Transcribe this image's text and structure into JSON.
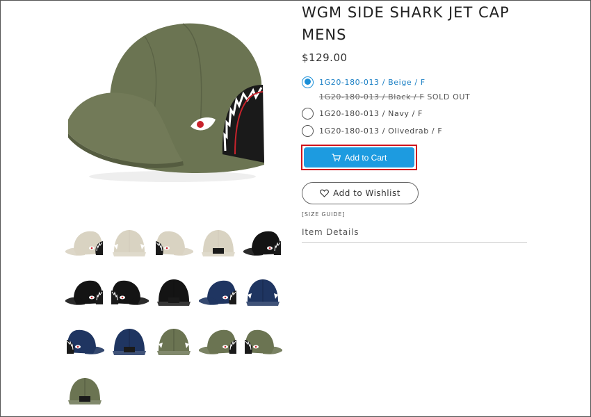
{
  "product": {
    "title": "WGM SIDE SHARK JET CAP MENS",
    "price": "$129.00"
  },
  "options": [
    {
      "label": "1G20-180-013 / Beige / F",
      "selected": true,
      "sold_out": false
    },
    {
      "label": "1G20-180-013 / Black / F",
      "selected": false,
      "sold_out": true,
      "sold_out_text": "SOLD OUT"
    },
    {
      "label": "1G20-180-013 / Navy / F",
      "selected": false,
      "sold_out": false
    },
    {
      "label": "1G20-180-013 / Olivedrab / F",
      "selected": false,
      "sold_out": false
    }
  ],
  "actions": {
    "add_to_cart": "Add to Cart",
    "add_to_wishlist": "Add to Wishlist",
    "size_guide": "[SIZE GUIDE]",
    "item_details": "Item Details"
  },
  "colors": {
    "accent": "#1d9be0",
    "highlight_outline": "#d0131b",
    "olive": "#6b7452",
    "beige": "#d9d3c2",
    "black": "#141414",
    "navy": "#1f3561"
  },
  "thumbnails": [
    {
      "color": "beige",
      "view": "side-left"
    },
    {
      "color": "beige",
      "view": "front"
    },
    {
      "color": "beige",
      "view": "side-right"
    },
    {
      "color": "beige",
      "view": "back"
    },
    {
      "color": "black",
      "view": "side-left"
    },
    {
      "color": "black",
      "view": "side-left"
    },
    {
      "color": "black",
      "view": "side-right"
    },
    {
      "color": "black",
      "view": "back"
    },
    {
      "color": "navy",
      "view": "side-left"
    },
    {
      "color": "navy",
      "view": "front"
    },
    {
      "color": "navy",
      "view": "side-right"
    },
    {
      "color": "navy",
      "view": "back"
    },
    {
      "color": "olive",
      "view": "front"
    },
    {
      "color": "olive",
      "view": "side-left"
    },
    {
      "color": "olive",
      "view": "side-right"
    },
    {
      "color": "olive",
      "view": "back"
    }
  ]
}
